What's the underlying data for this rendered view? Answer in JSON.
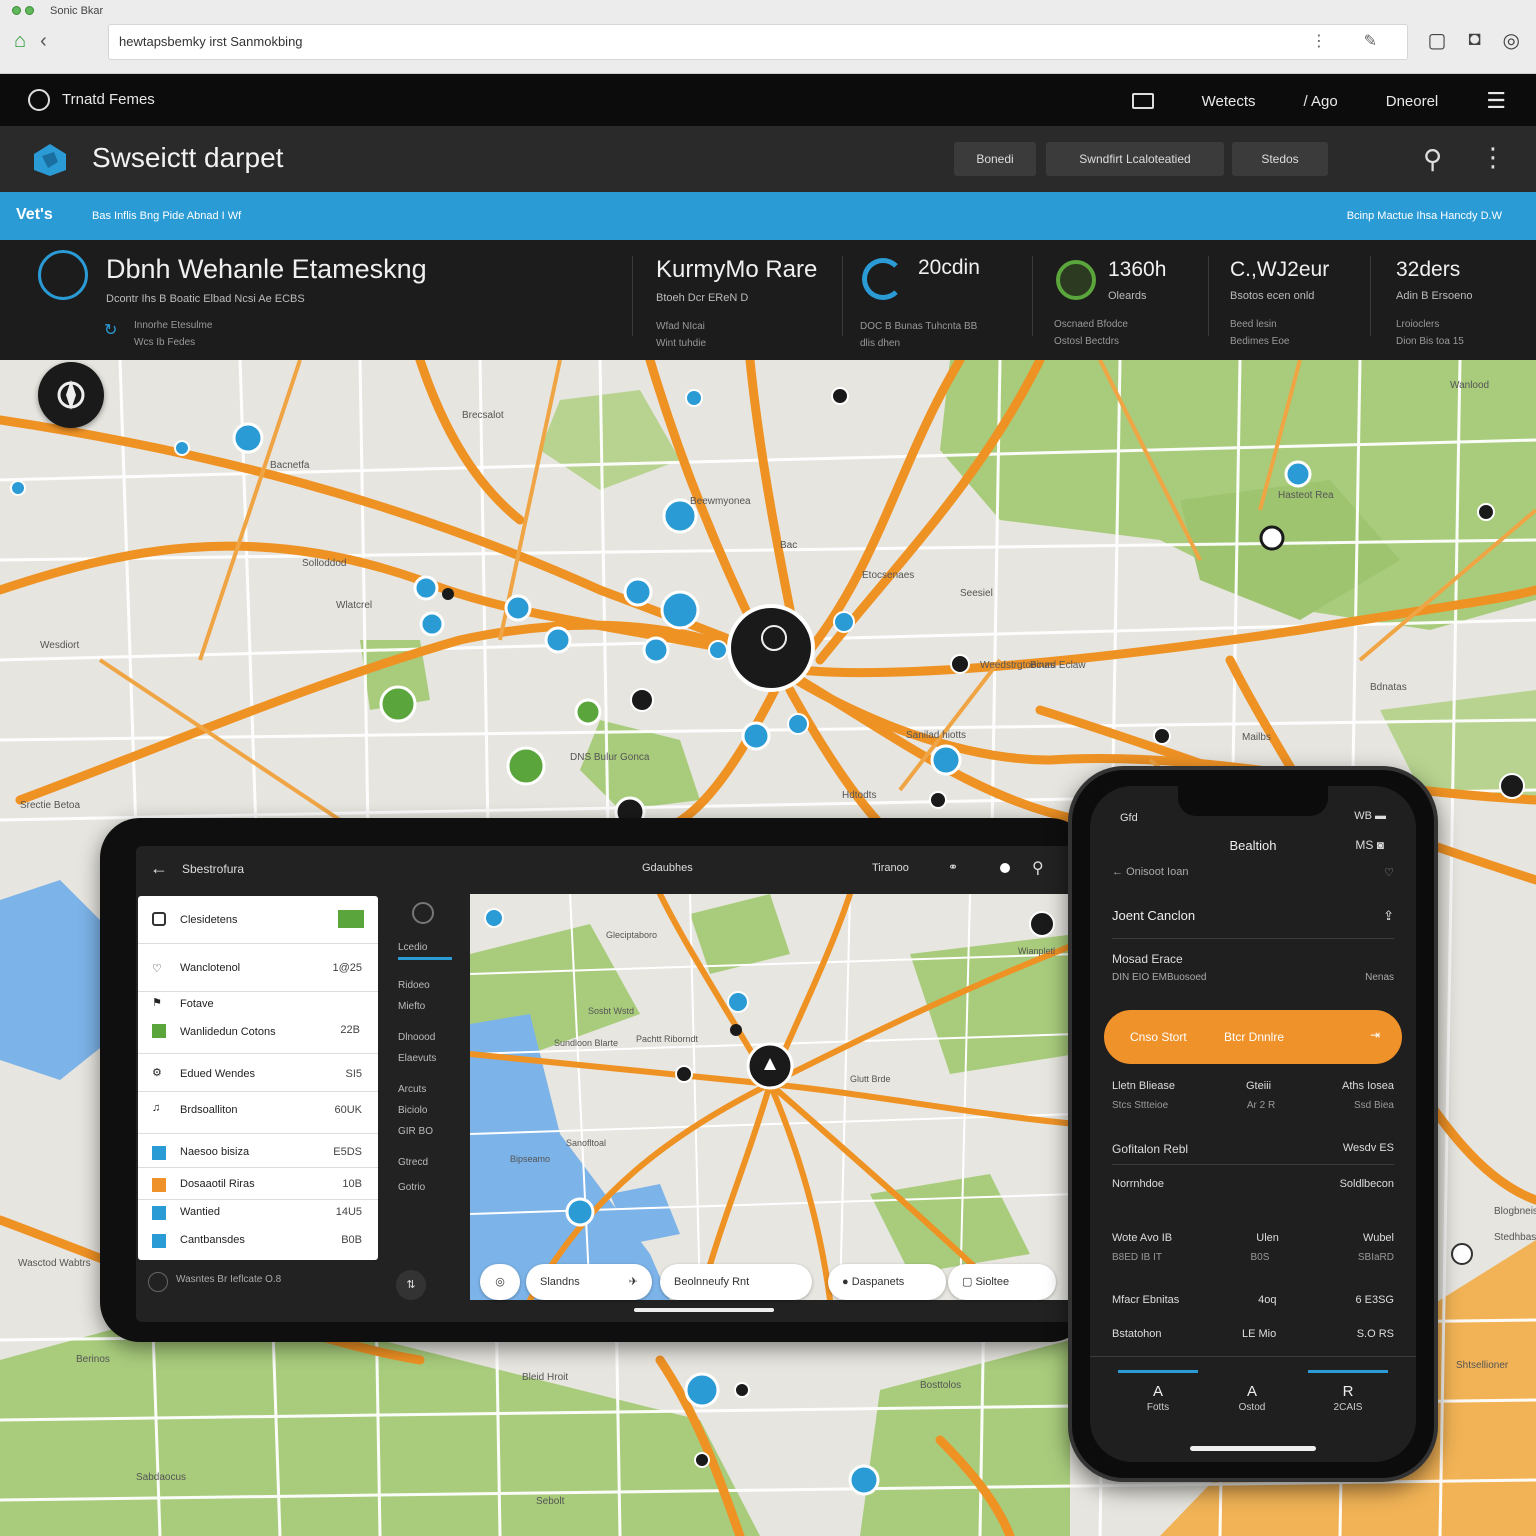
{
  "browser": {
    "tab_title": "Sonic Bkar",
    "url": "hewtapsbemky irst Sanmokbing"
  },
  "app_bar": {
    "name": "Trnatd Femes",
    "menu": [
      "Wetects",
      "/ Ago",
      "Dneorel"
    ]
  },
  "sub_bar": {
    "title": "Swseictt darpet",
    "pills": [
      "Bonedi",
      "Swndfirt Lcaloteatied",
      "Stedos"
    ]
  },
  "blue_bar": {
    "left": "Vet's",
    "left_sub": "Bas Inflis Bng Pide Abnad I Wf",
    "right": "Bcinp Mactue Ihsa Hancdy D.W"
  },
  "stats": {
    "main": {
      "title": "Dbnh Wehanle Etameskng",
      "sub": "Dcontr Ihs B Boatic Elbad Ncsi Ae ECBS",
      "line1": "Innorhe Etesulme",
      "line2": "Wcs Ib Fedes"
    },
    "s2": {
      "big": "KurmyMo Rare",
      "small": "Btoeh Dcr EReN D",
      "tiny1": "Wfad NIcai",
      "tiny2": "Wint tuhdie"
    },
    "s3": {
      "big": "20cdin",
      "tiny1": "DOC B Bunas Tuhcnta BB",
      "tiny2": "dlis dhen"
    },
    "s4": {
      "big": "1360h",
      "small": "Oleards",
      "tiny1": "Oscnaed Bfodce",
      "tiny2": "Ostosl Bectdrs"
    },
    "s5": {
      "big": "C.,WJ2eur",
      "small": "Bsotos ecen onld",
      "tiny1": "Beed lesin",
      "tiny2": "Bedimes Eoe"
    },
    "s6": {
      "big": "32ders",
      "small": "Adin B Ersoeno",
      "tiny1": "Lroioclers",
      "tiny2": "Dion Bis toa 15"
    }
  },
  "map_labels": [
    "Brecsalot",
    "Bacnetfa",
    "Solloddod",
    "Wesdiort",
    "Beewmyonea",
    "Bac",
    "Etocsenaes",
    "Seesiel",
    "Hasteot Rea",
    "Bdnatas",
    "Mailbs",
    "Wanlood",
    "Weedstrgtoeinas",
    "Bcurd Eclaw",
    "DNS Bulur Gonca",
    "Sanilad hiotts",
    "Srectie Betoa",
    "Hdtodts",
    "Wlatcrel",
    "Berinos",
    "Bleid Hroit",
    "Bosttolos",
    "Sebolt",
    "Shtsellioner",
    "Blogbneiss",
    "Stedhbas",
    "Sabdaocus",
    "Wasctod Wabtrs"
  ],
  "tablet": {
    "header_left": "Sbestrofura",
    "header_mid": "Gdaubhes",
    "header_right": "Tiranoo",
    "list": [
      {
        "label": "Clesidetens",
        "value": "",
        "icon": "home-icon"
      },
      {
        "label": "Wanclotenol",
        "value": "1@25",
        "icon": "heart-icon"
      },
      {
        "label": "Fotave",
        "value": "",
        "icon": "flag-icon"
      },
      {
        "label": "Wanlidedun Cotons",
        "value": "22B",
        "icon": "grid-icon"
      },
      {
        "label": "Edued Wendes",
        "value": "SI5",
        "icon": "gear-icon"
      },
      {
        "label": "Brdsoalliton",
        "value": "60UK",
        "icon": "music-icon"
      },
      {
        "label": "Naesoo bisiza",
        "value": "E5DS",
        "icon": "square-icon"
      },
      {
        "label": "Dosaaotil Riras",
        "value": "10B",
        "icon": "square-icon"
      },
      {
        "label": "Wantied",
        "value": "14U5",
        "icon": "square-icon"
      },
      {
        "label": "Cantbansdes",
        "value": "B0B",
        "icon": "square-icon"
      }
    ],
    "footer": "Wasntes Br Ieflcate O.8",
    "side_items": [
      "Lcedio",
      "Ridoeo",
      "Miefto",
      "Dlnoood",
      "Elaevuts",
      "Arcuts",
      "Biciolo",
      "GIR BO",
      "Gtrecd",
      "Gotrio"
    ],
    "map_labels": [
      "Gleciptaboro",
      "Wianpletl",
      "Sosbt Wstd",
      "Sundloon Blarte",
      "Pachtt Riborndt",
      "Glutt Brde",
      "Sanofltoal",
      "Bipseamo"
    ],
    "chips": [
      "Slandns",
      "Beolnneufy Rnt",
      "Daspanets",
      "Sioltee"
    ]
  },
  "phone": {
    "status_left": "Gfd",
    "status_right": "WB",
    "title": "Bealtioh",
    "back_label": "Onisoot Ioan",
    "section": "Joent Canclon",
    "item_label": "Mosad Erace",
    "item_sub": "DIN EIO EMBuosoed",
    "item_right": "Nenas",
    "button_left": "Cnso Stort",
    "button_mid": "Btcr Dnnlre",
    "grid1": [
      [
        "Lletn Bliease",
        "Gteiii",
        "Aths Iosea"
      ],
      [
        "Stcs Sttteioe",
        "Ar 2 R",
        "Ssd Biea"
      ]
    ],
    "row_a": [
      "Gofitalon Rebl",
      "Wesdv ES"
    ],
    "row_b": [
      "Norrnhdoe",
      "Soldlbecon"
    ],
    "grid2": [
      [
        "Wote Avo IB",
        "Ulen",
        "Wubel"
      ],
      [
        "B8ED IB IT",
        "B0S",
        "SBIaRD"
      ]
    ],
    "row_c": [
      "Mfacr Ebnitas",
      "4oq",
      "6 E3SG"
    ],
    "row_d": [
      "Bstatohon",
      "LE Mio",
      "S.O RS"
    ],
    "tabs": [
      {
        "icon": "A",
        "label": "Fotts"
      },
      {
        "icon": "A",
        "label": "Ostod"
      },
      {
        "icon": "R",
        "label": "2CAIS"
      }
    ]
  },
  "colors": {
    "accent_blue": "#2b9bd6",
    "road_orange": "#ef9224",
    "park_green": "#a8cc7c",
    "water_blue": "#7cb3e8",
    "panel_dark": "#1c1c1c"
  }
}
